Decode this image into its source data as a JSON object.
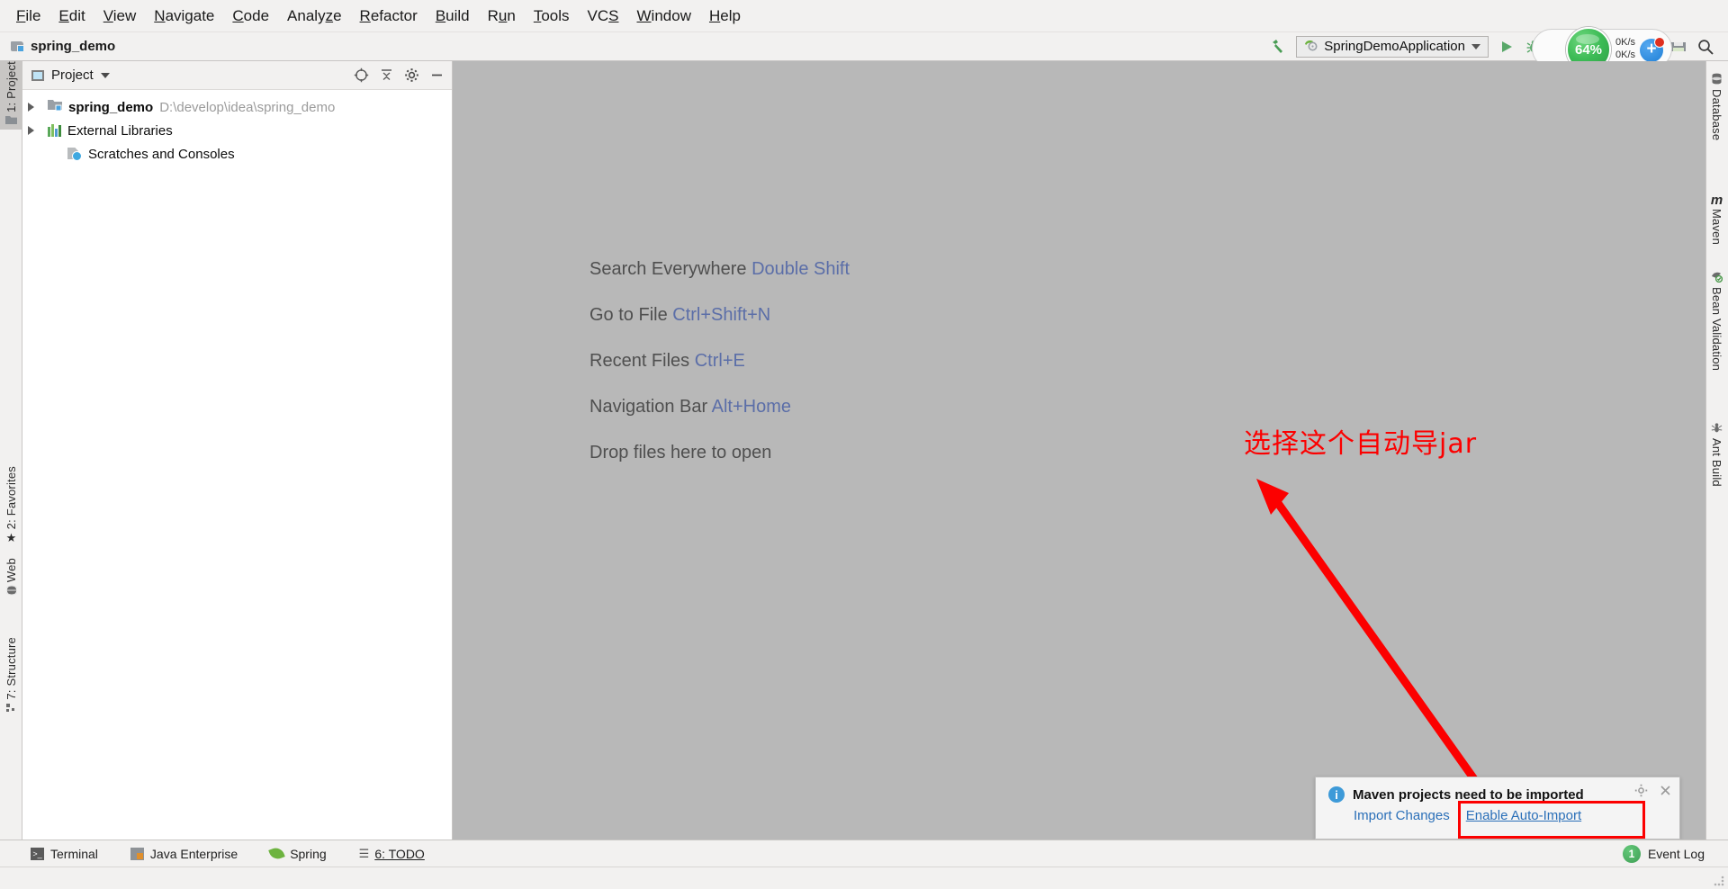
{
  "window": {
    "project_label": "spring_demo",
    "folder_icon": "project-folder-icon"
  },
  "menubar": {
    "items": [
      {
        "pre": "",
        "mn": "F",
        "post": "ile"
      },
      {
        "pre": "",
        "mn": "E",
        "post": "dit"
      },
      {
        "pre": "",
        "mn": "V",
        "post": "iew"
      },
      {
        "pre": "",
        "mn": "N",
        "post": "avigate"
      },
      {
        "pre": "",
        "mn": "C",
        "post": "ode"
      },
      {
        "pre": "Analy",
        "mn": "z",
        "post": "e"
      },
      {
        "pre": "",
        "mn": "R",
        "post": "efactor"
      },
      {
        "pre": "",
        "mn": "B",
        "post": "uild"
      },
      {
        "pre": "R",
        "mn": "u",
        "post": "n"
      },
      {
        "pre": "",
        "mn": "T",
        "post": "ools"
      },
      {
        "pre": "VC",
        "mn": "S",
        "post": ""
      },
      {
        "pre": "",
        "mn": "W",
        "post": "indow"
      },
      {
        "pre": "",
        "mn": "H",
        "post": "elp"
      }
    ]
  },
  "toolbar": {
    "build_icon": "hammer-icon",
    "run_config": {
      "icon": "spring-boot-run-config-icon",
      "label": "SpringDemoApplication",
      "chevron": "chevron-down-icon"
    },
    "run_icon": "run-play-icon",
    "debug_icon": "debug-bug-icon",
    "run_with_coverage_icon": "run-with-coverage-icon",
    "settings_icon": "settings-gear-icon",
    "project_structure_icon": "project-structure-icon",
    "open_icon": "open-folder-icon",
    "save_icon": "save-all-icon",
    "search_icon": "search-icon",
    "memory": {
      "gauge_value": "64%",
      "upload_rate": "0K/s",
      "download_rate": "0K/s",
      "upload_icon": "arrow-up-icon",
      "download_icon": "arrow-down-icon",
      "plus_badge": "+"
    }
  },
  "left_strip": {
    "tabs": [
      {
        "label": "1: Project",
        "icon": "project-folder-icon",
        "active": true
      },
      {
        "label": "2: Favorites",
        "icon": "star-icon",
        "active": false
      },
      {
        "label": "Web",
        "icon": "globe-icon",
        "active": false
      },
      {
        "label": "7: Structure",
        "icon": "structure-icon",
        "active": false
      }
    ]
  },
  "right_strip": {
    "tabs": [
      {
        "label": "Database",
        "icon": "database-icon"
      },
      {
        "label": "Maven",
        "icon": "maven-m-icon"
      },
      {
        "label": "Bean Validation",
        "icon": "bean-validation-icon"
      },
      {
        "label": "Ant Build",
        "icon": "ant-build-icon"
      }
    ]
  },
  "project_panel": {
    "title": "Project",
    "view_icon": "project-view-icon",
    "dropdown_icon": "chevron-down-icon",
    "locate_icon": "scroll-from-source-icon",
    "collapse_icon": "collapse-all-icon",
    "settings_icon": "gear-icon",
    "hide_icon": "hide-icon",
    "tree": [
      {
        "name": "spring_demo",
        "path": "D:\\develop\\idea\\spring_demo",
        "icon": "module-folder-icon",
        "expandable": true
      },
      {
        "name": "External Libraries",
        "path": "",
        "icon": "libraries-icon",
        "expandable": true
      },
      {
        "name": "Scratches and Consoles",
        "path": "",
        "icon": "scratches-icon",
        "expandable": false
      }
    ]
  },
  "editor": {
    "shortcuts": [
      {
        "action": "Search Everywhere",
        "key": "Double Shift"
      },
      {
        "action": "Go to File",
        "key": "Ctrl+Shift+N"
      },
      {
        "action": "Recent Files",
        "key": "Ctrl+E"
      },
      {
        "action": "Navigation Bar",
        "key": "Alt+Home"
      },
      {
        "action": "Drop files here to open",
        "key": ""
      }
    ]
  },
  "annotations": {
    "note_text": "选择这个自动导jar",
    "note_color": "#fc0000",
    "arrow": "red-arrow-pointing-up-left",
    "highlight_box": "red-rectangle-around-enable-auto-import"
  },
  "balloon": {
    "info_icon": "info-icon",
    "title": "Maven projects need to be imported",
    "actions": [
      {
        "label": "Import Changes",
        "underlined": false
      },
      {
        "label": "Enable Auto-Import",
        "underlined": true
      }
    ],
    "gear_icon": "gear-icon",
    "close_icon": "close-icon"
  },
  "statusbar": {
    "items": [
      {
        "label": "Terminal",
        "icon": "terminal-icon",
        "mnemonic": ""
      },
      {
        "label": "Java Enterprise",
        "icon": "java-enterprise-icon",
        "mnemonic": ""
      },
      {
        "label": "Spring",
        "icon": "spring-leaf-icon",
        "mnemonic": ""
      },
      {
        "label": "6: TODO",
        "icon": "todo-list-icon",
        "mnemonic": "6"
      }
    ],
    "event_log": {
      "count": "1",
      "label": "Event Log"
    }
  }
}
